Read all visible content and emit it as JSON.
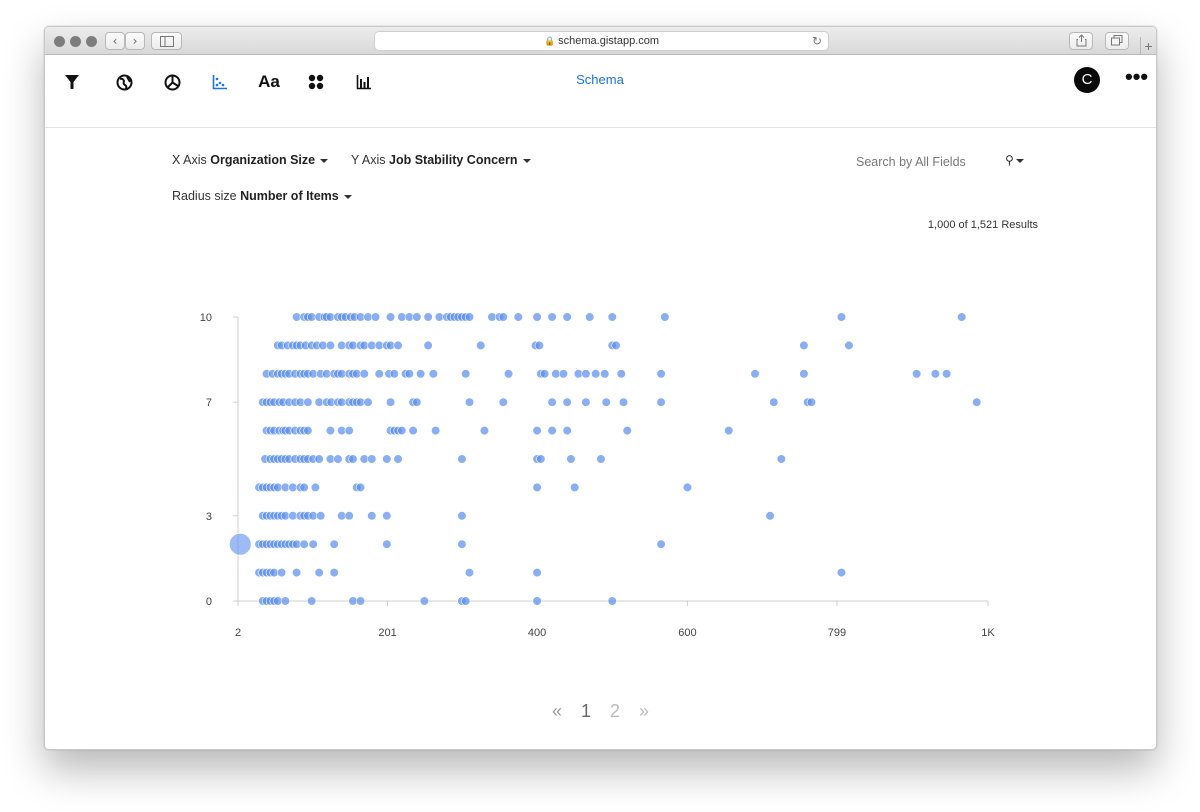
{
  "browser": {
    "url": "schema.gistapp.com",
    "nav_back": "‹",
    "nav_forward": "›"
  },
  "toolbar": {
    "icons": [
      "filter-icon",
      "globe-icon",
      "pie-chart-icon",
      "scatter-plot-icon",
      "text-icon",
      "grid-icon",
      "bar-chart-icon"
    ],
    "active_icon": "scatter-plot-icon",
    "title": "Schema",
    "avatar_letter": "C",
    "more_label": "•••"
  },
  "controls": {
    "x_axis_label": "X Axis",
    "x_axis_value": "Organization Size",
    "y_axis_label": "Y Axis",
    "y_axis_value": "Job Stability Concern",
    "radius_label": "Radius size",
    "radius_value": "Number of Items",
    "search_placeholder": "Search by All Fields",
    "results_text": "1,000 of 1,521 Results"
  },
  "colors": {
    "accent": "#1a73e8",
    "point": "#5b8ff0"
  },
  "chart_data": {
    "type": "scatter",
    "title": "",
    "xlabel": "",
    "ylabel": "",
    "x_ticks": [
      {
        "v": 2,
        "label": "2"
      },
      {
        "v": 201,
        "label": "201"
      },
      {
        "v": 400,
        "label": "400"
      },
      {
        "v": 600,
        "label": "600"
      },
      {
        "v": 799,
        "label": "799"
      },
      {
        "v": 1000,
        "label": "1K"
      }
    ],
    "y_ticks": [
      {
        "v": 0,
        "label": "0"
      },
      {
        "v": 3,
        "label": "3"
      },
      {
        "v": 7,
        "label": "7"
      },
      {
        "v": 10,
        "label": "10"
      }
    ],
    "xlim": [
      2,
      1000
    ],
    "ylim": [
      0,
      10
    ],
    "grid": false,
    "rows": [
      {
        "y": 10,
        "x": [
          80,
          90,
          95,
          100,
          110,
          117,
          120,
          125,
          135,
          140,
          145,
          152,
          157,
          165,
          175,
          185,
          205,
          220,
          230,
          240,
          255,
          270,
          280,
          285,
          290,
          295,
          300,
          305,
          310,
          340,
          350,
          355,
          375,
          400,
          420,
          440,
          470,
          500,
          570,
          805,
          965
        ]
      },
      {
        "y": 9,
        "x": [
          55,
          60,
          68,
          75,
          80,
          85,
          92,
          100,
          107,
          115,
          125,
          140,
          150,
          155,
          165,
          170,
          180,
          190,
          200,
          205,
          215,
          255,
          325,
          398,
          403,
          500,
          505,
          755,
          815
        ]
      },
      {
        "y": 8,
        "x": [
          40,
          48,
          55,
          60,
          65,
          70,
          78,
          85,
          90,
          95,
          102,
          112,
          120,
          130,
          135,
          140,
          150,
          155,
          160,
          170,
          190,
          203,
          210,
          225,
          230,
          245,
          262,
          305,
          362,
          405,
          410,
          425,
          435,
          455,
          465,
          478,
          490,
          512,
          565,
          690,
          755,
          905,
          930,
          945
        ]
      },
      {
        "y": 7,
        "x": [
          35,
          40,
          45,
          50,
          57,
          62,
          70,
          78,
          85,
          95,
          110,
          120,
          126,
          135,
          140,
          150,
          155,
          160,
          165,
          175,
          205,
          235,
          240,
          310,
          355,
          420,
          440,
          465,
          492,
          515,
          565,
          715,
          760,
          765,
          985
        ]
      },
      {
        "y": 6,
        "x": [
          40,
          45,
          50,
          57,
          62,
          65,
          70,
          78,
          85,
          90,
          95,
          125,
          140,
          150,
          205,
          210,
          215,
          220,
          235,
          265,
          330,
          400,
          420,
          440,
          520,
          655
        ]
      },
      {
        "y": 5,
        "x": [
          38,
          45,
          50,
          55,
          60,
          65,
          70,
          78,
          85,
          90,
          95,
          102,
          110,
          125,
          135,
          150,
          155,
          170,
          180,
          200,
          215,
          300,
          400,
          405,
          445,
          485,
          725
        ]
      },
      {
        "y": 4,
        "x": [
          30,
          35,
          40,
          45,
          50,
          55,
          65,
          75,
          85,
          90,
          105,
          160,
          165,
          400,
          450,
          600
        ]
      },
      {
        "y": 3,
        "x": [
          35,
          40,
          45,
          50,
          55,
          60,
          65,
          75,
          85,
          90,
          95,
          102,
          112,
          140,
          150,
          180,
          200,
          300,
          710
        ]
      },
      {
        "y": 2,
        "x": [
          30,
          35,
          40,
          45,
          50,
          55,
          60,
          65,
          70,
          75,
          80,
          90,
          102,
          130,
          200,
          300,
          565
        ]
      },
      {
        "y": 1,
        "x": [
          30,
          35,
          40,
          45,
          50,
          60,
          80,
          110,
          130,
          310,
          400,
          805
        ]
      },
      {
        "y": 0,
        "x": [
          35,
          40,
          45,
          50,
          55,
          65,
          100,
          155,
          165,
          250,
          300,
          305,
          400,
          500
        ]
      }
    ],
    "highlight": {
      "x": 5,
      "y": 2
    }
  },
  "pagination": {
    "prev": "«",
    "pages": [
      "1",
      "2"
    ],
    "current": "1",
    "next": "»"
  }
}
